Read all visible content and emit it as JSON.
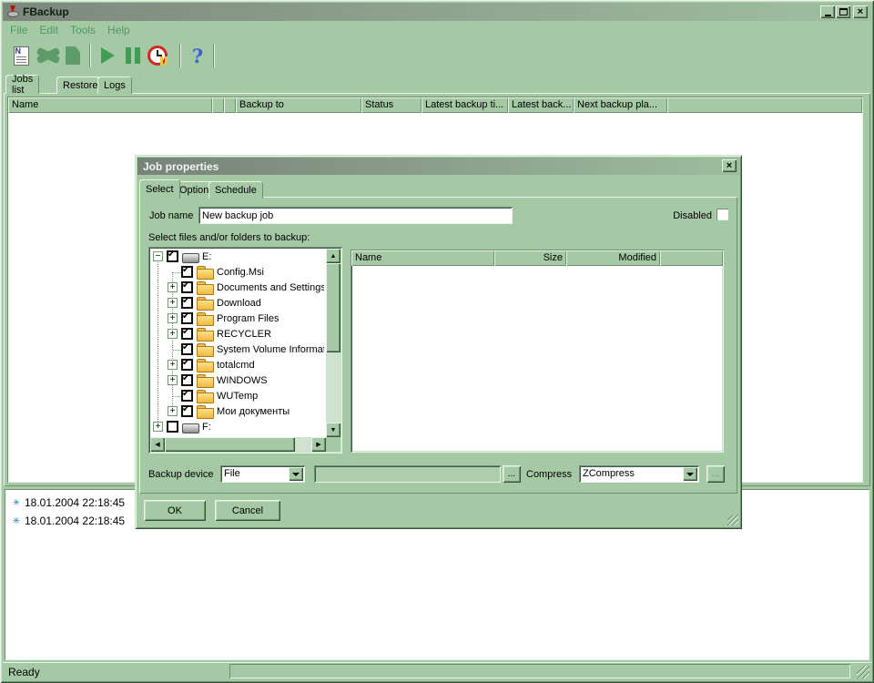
{
  "colors": {
    "window_face": "#a5c8a5",
    "menu_text_green": "#4f9a5f",
    "title_gradient_left": "#7d877d",
    "title_gradient_right": "#a0c0a0",
    "toolbar_green": "#3f9e53",
    "clock_red": "#cf2b20",
    "help_blue": "#3a62d6",
    "folder_yellow": "#f0bf4a",
    "log_star_teal": "#1f7fa8"
  },
  "window": {
    "title": "FBackup",
    "controls": [
      "minimize-icon",
      "maximize-icon",
      "close-icon"
    ],
    "menu": [
      {
        "label": "File"
      },
      {
        "label": "Edit"
      },
      {
        "label": "Tools"
      },
      {
        "label": "Help"
      }
    ],
    "toolbar_icons": [
      "new-job-icon",
      "job-properties-icon",
      "duplicate-job-icon",
      "start-backup-icon",
      "pause-backup-icon",
      "scheduler-clock-icon",
      "help-icon"
    ],
    "tabs": [
      {
        "label": "Jobs list"
      },
      {
        "label": "Restore"
      },
      {
        "label": "Logs"
      }
    ],
    "active_tab": "Jobs list"
  },
  "jobs_table": {
    "columns": [
      "Name",
      "",
      "",
      "Backup to",
      "Status",
      "Latest backup ti...",
      "Latest back...",
      "Next backup pla..."
    ]
  },
  "log_panel": {
    "entries": [
      {
        "text": "18.01.2004 22:18:45"
      },
      {
        "text": "18.01.2004 22:18:45"
      }
    ]
  },
  "status_bar": {
    "text": "Ready"
  },
  "dialog": {
    "title": "Job properties",
    "tabs": [
      {
        "label": "Select"
      },
      {
        "label": "Options"
      },
      {
        "label": "Schedule"
      }
    ],
    "active_tab": "Select",
    "job_name": {
      "label": "Job name",
      "value": "New backup job"
    },
    "disabled_checkbox": {
      "label": "Disabled",
      "checked": false
    },
    "tree_label": "Select files and/or folders to backup:",
    "tree": [
      {
        "label": "E:",
        "icon": "drive",
        "level": "l0",
        "expander": "minus",
        "check": "checked"
      },
      {
        "label": "Config.Msi",
        "icon": "folder",
        "level": "l1",
        "expander": "none",
        "check": "checked"
      },
      {
        "label": "Documents and Settings",
        "icon": "folder",
        "level": "l1",
        "expander": "plus",
        "check": "checked"
      },
      {
        "label": "Download",
        "icon": "folder",
        "level": "l1",
        "expander": "plus",
        "check": "checked"
      },
      {
        "label": "Program Files",
        "icon": "folder",
        "level": "l1",
        "expander": "plus",
        "check": "checked"
      },
      {
        "label": "RECYCLER",
        "icon": "folder",
        "level": "l1",
        "expander": "plus",
        "check": "checked"
      },
      {
        "label": "System Volume Informatio",
        "icon": "folder",
        "level": "l1",
        "expander": "none",
        "check": "checked"
      },
      {
        "label": "totalcmd",
        "icon": "folder",
        "level": "l1",
        "expander": "plus",
        "check": "checked"
      },
      {
        "label": "WINDOWS",
        "icon": "folder",
        "level": "l1",
        "expander": "plus",
        "check": "checked"
      },
      {
        "label": "WUTemp",
        "icon": "folder",
        "level": "l1",
        "expander": "none",
        "check": "checked"
      },
      {
        "label": "Мои документы",
        "icon": "folder",
        "level": "l1",
        "expander": "plus",
        "check": "checked"
      },
      {
        "label": "F:",
        "icon": "drive",
        "level": "l0",
        "expander": "plus",
        "check": "unchecked"
      }
    ],
    "file_list": {
      "columns": [
        "Name",
        "Size",
        "Modified"
      ]
    },
    "backup_device": {
      "label": "Backup device",
      "value": "File"
    },
    "browse_button": "...",
    "compress": {
      "label": "Compress",
      "value": "ZCompress"
    },
    "compress_browse_button": "...",
    "ok_button": "OK",
    "cancel_button": "Cancel"
  }
}
